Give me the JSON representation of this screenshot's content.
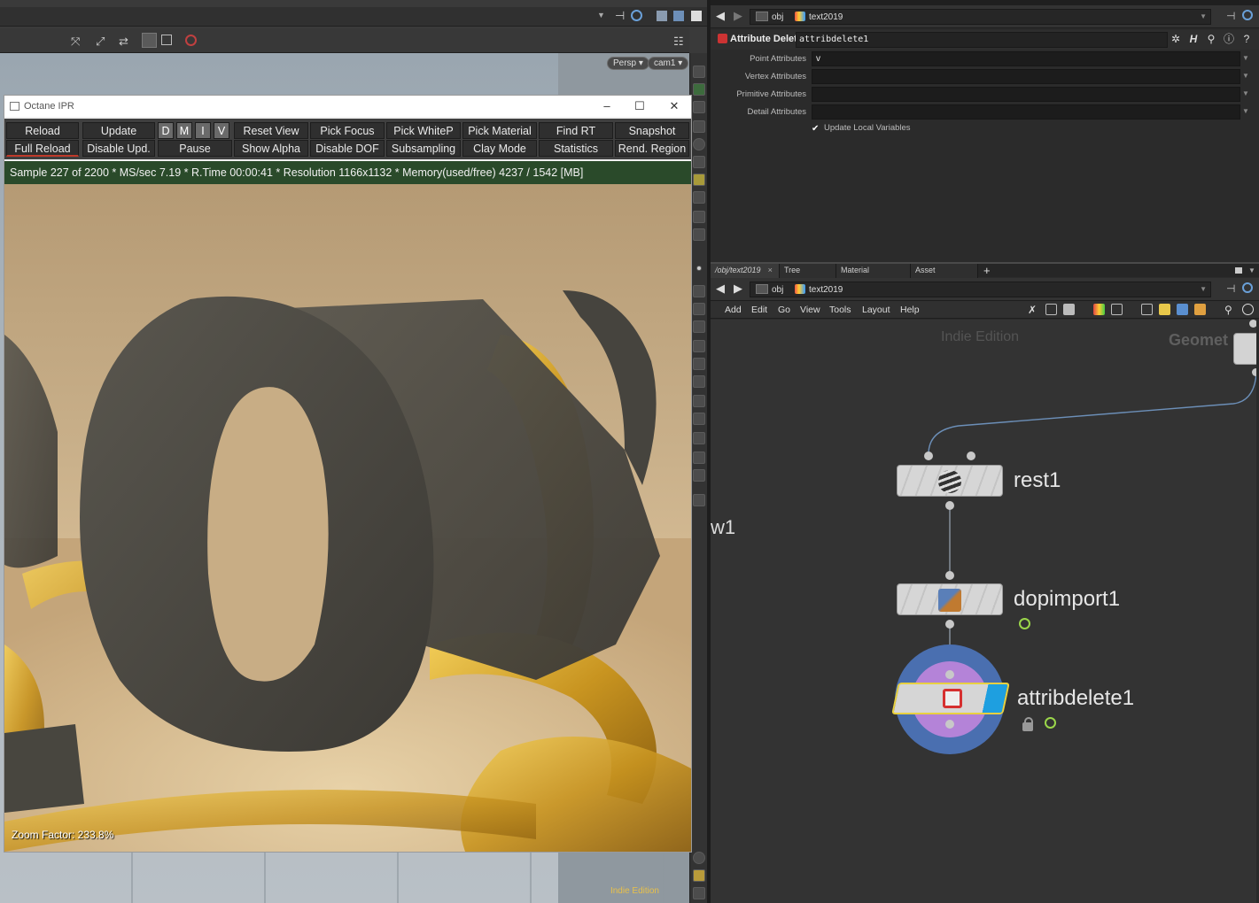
{
  "viewer": {
    "persp_label": "Persp",
    "cam_label": "cam1",
    "indie_edition": "Indie Edition"
  },
  "octane": {
    "title": "Octane IPR",
    "toolbar_row1": [
      "Reload",
      "Update",
      "D",
      "M",
      "I",
      "V",
      "Reset View",
      "Pick Focus",
      "Pick WhiteP",
      "Pick Material",
      "Find RT",
      "Snapshot"
    ],
    "toolbar_row2": [
      "Full Reload",
      "Disable Upd.",
      "Pause",
      "Show Alpha",
      "Disable DOF",
      "Subsampling",
      "Clay Mode",
      "Statistics",
      "Rend. Region"
    ],
    "status": "Sample 227 of 2200 * MS/sec 7.19 * R.Time 00:00:41 * Resolution 1166x1132 * Memory(used/free) 4237 / 1542 [MB]",
    "zoom_factor": "Zoom Factor: 233.8%"
  },
  "params": {
    "path_obj": "obj",
    "path_node": "text2019",
    "node_type": "Attribute Delete",
    "node_name": "attribdelete1",
    "rows": [
      {
        "label": "Point Attributes",
        "value": "v"
      },
      {
        "label": "Vertex Attributes",
        "value": ""
      },
      {
        "label": "Primitive Attributes",
        "value": ""
      },
      {
        "label": "Detail Attributes",
        "value": ""
      }
    ],
    "update_local_vars": "Update Local Variables"
  },
  "network": {
    "tabs": [
      "/obj/text2019",
      "Tree View",
      "Material Palette",
      "Asset Browser"
    ],
    "path_obj": "obj",
    "path_node": "text2019",
    "menu": [
      "Add",
      "Edit",
      "Go",
      "View",
      "Tools",
      "Layout",
      "Help"
    ],
    "indie_edition": "Indie Edition",
    "geo_label": "Geomet",
    "edge_label": "w1",
    "nodes": [
      {
        "name": "rest1"
      },
      {
        "name": "dopimport1"
      },
      {
        "name": "attribdelete1"
      }
    ]
  },
  "colors": {
    "status_bg": "#2a4a2a",
    "selected_node_ring": "#4a6fb0",
    "selected_node_inner": "#b483d8",
    "display_flag": "#1e9fe0",
    "clock_icon": "#9bd64a",
    "indie_left": "#e8c04a"
  }
}
